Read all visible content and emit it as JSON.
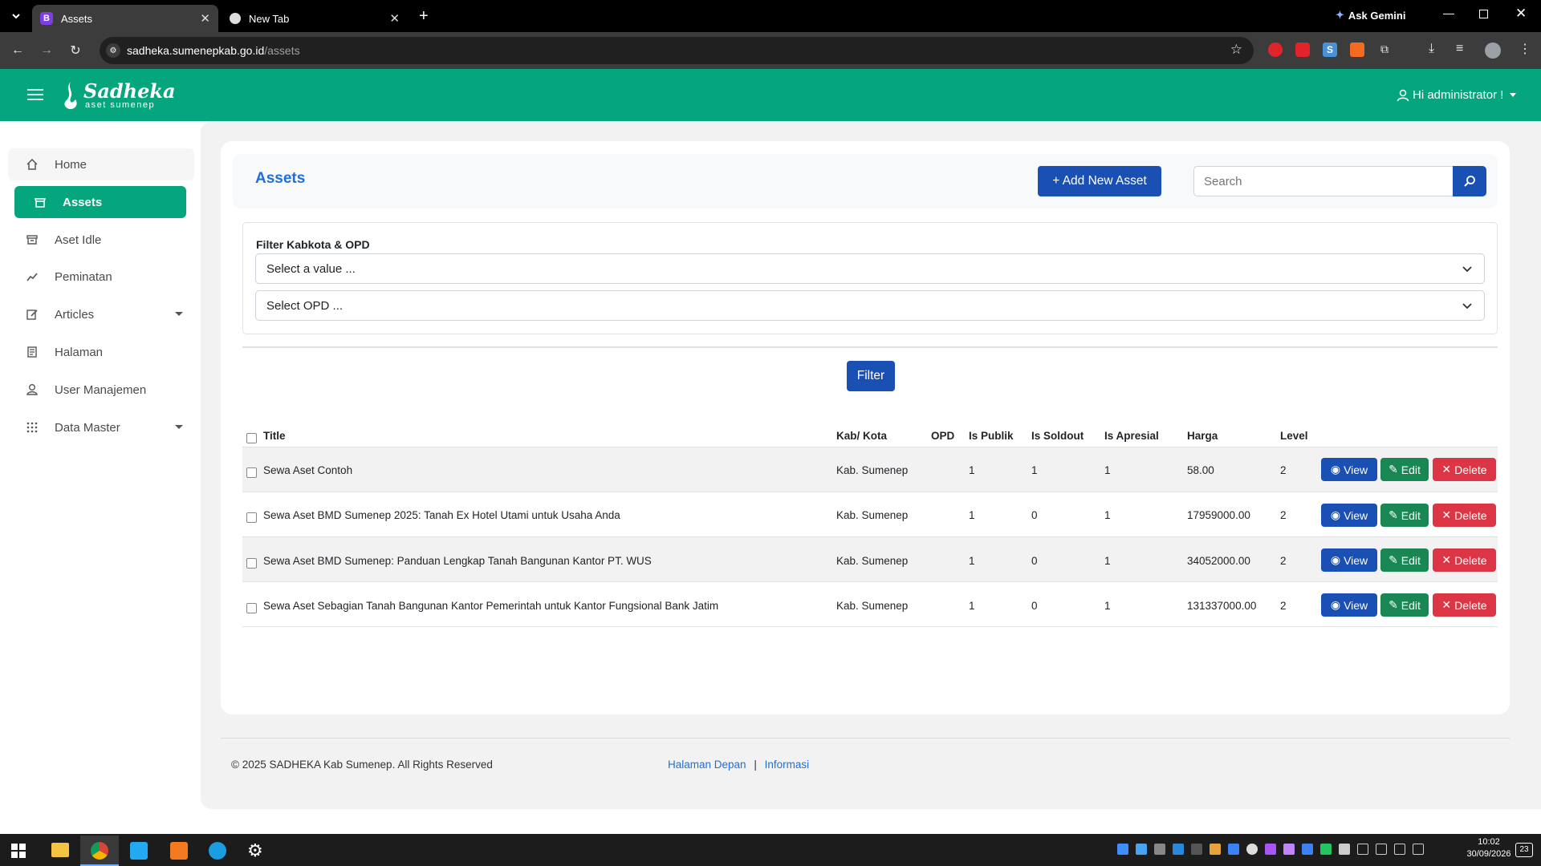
{
  "browser": {
    "tabs": [
      {
        "label": "Assets",
        "favicon": "B"
      },
      {
        "label": "New Tab"
      }
    ],
    "ask_gemini": "Ask Gemini",
    "url_host": "sadheka.sumenepkab.go.id",
    "url_path": "/assets"
  },
  "app": {
    "logo_main": "Sadheka",
    "logo_sub": "aset sumenep",
    "user_greeting": "Hi administrator !",
    "accent": "#05a67e"
  },
  "sidebar": {
    "items": [
      {
        "label": "Home",
        "icon": "home-icon"
      },
      {
        "label": "Assets",
        "icon": "store-icon"
      },
      {
        "label": "Aset Idle",
        "icon": "archive-icon"
      },
      {
        "label": "Peminatan",
        "icon": "chart-line-icon"
      },
      {
        "label": "Articles",
        "icon": "edit-icon"
      },
      {
        "label": "Halaman",
        "icon": "page-icon"
      },
      {
        "label": "User Manajemen",
        "icon": "user-icon"
      },
      {
        "label": "Data Master",
        "icon": "grid-icon"
      }
    ]
  },
  "main": {
    "title": "Assets",
    "add_button": "+ Add New Asset",
    "search_placeholder": "Search",
    "filter_title": "Filter Kabkota & OPD",
    "select_kabkota": "Select a value ...",
    "select_opd": "Select OPD ...",
    "filter_button": "Filter",
    "columns": [
      "Title",
      "Kab/ Kota",
      "OPD",
      "Is Publik",
      "Is Soldout",
      "Is Apresial",
      "Harga",
      "Level"
    ],
    "rows": [
      {
        "title": "Sewa Aset Contoh",
        "kab": "Kab. Sumenep",
        "opd": "",
        "publik": "1",
        "soldout": "1",
        "apresial": "1",
        "harga": "58.00",
        "level": "2"
      },
      {
        "title": "Sewa Aset BMD Sumenep 2025: Tanah Ex Hotel Utami untuk Usaha Anda",
        "kab": "Kab. Sumenep",
        "opd": "",
        "publik": "1",
        "soldout": "0",
        "apresial": "1",
        "harga": "17959000.00",
        "level": "2"
      },
      {
        "title": "Sewa Aset BMD Sumenep: Panduan Lengkap Tanah Bangunan Kantor PT. WUS",
        "kab": "Kab. Sumenep",
        "opd": "",
        "publik": "1",
        "soldout": "0",
        "apresial": "1",
        "harga": "34052000.00",
        "level": "2"
      },
      {
        "title": "Sewa Aset Sebagian Tanah Bangunan Kantor Pemerintah untuk Kantor Fungsional Bank Jatim",
        "kab": "Kab. Sumenep",
        "opd": "",
        "publik": "1",
        "soldout": "0",
        "apresial": "1",
        "harga": "131337000.00",
        "level": "2"
      }
    ],
    "actions": {
      "view": "View",
      "edit": "Edit",
      "delete": "Delete"
    }
  },
  "footer": {
    "copyright": "© 2025 SADHEKA Kab Sumenep. All Rights Reserved",
    "link1": "Halaman Depan",
    "separator": "|",
    "link2": "Informasi"
  },
  "taskbar": {
    "time": "10:02",
    "date": "30/09/2026",
    "notifications": "23"
  }
}
